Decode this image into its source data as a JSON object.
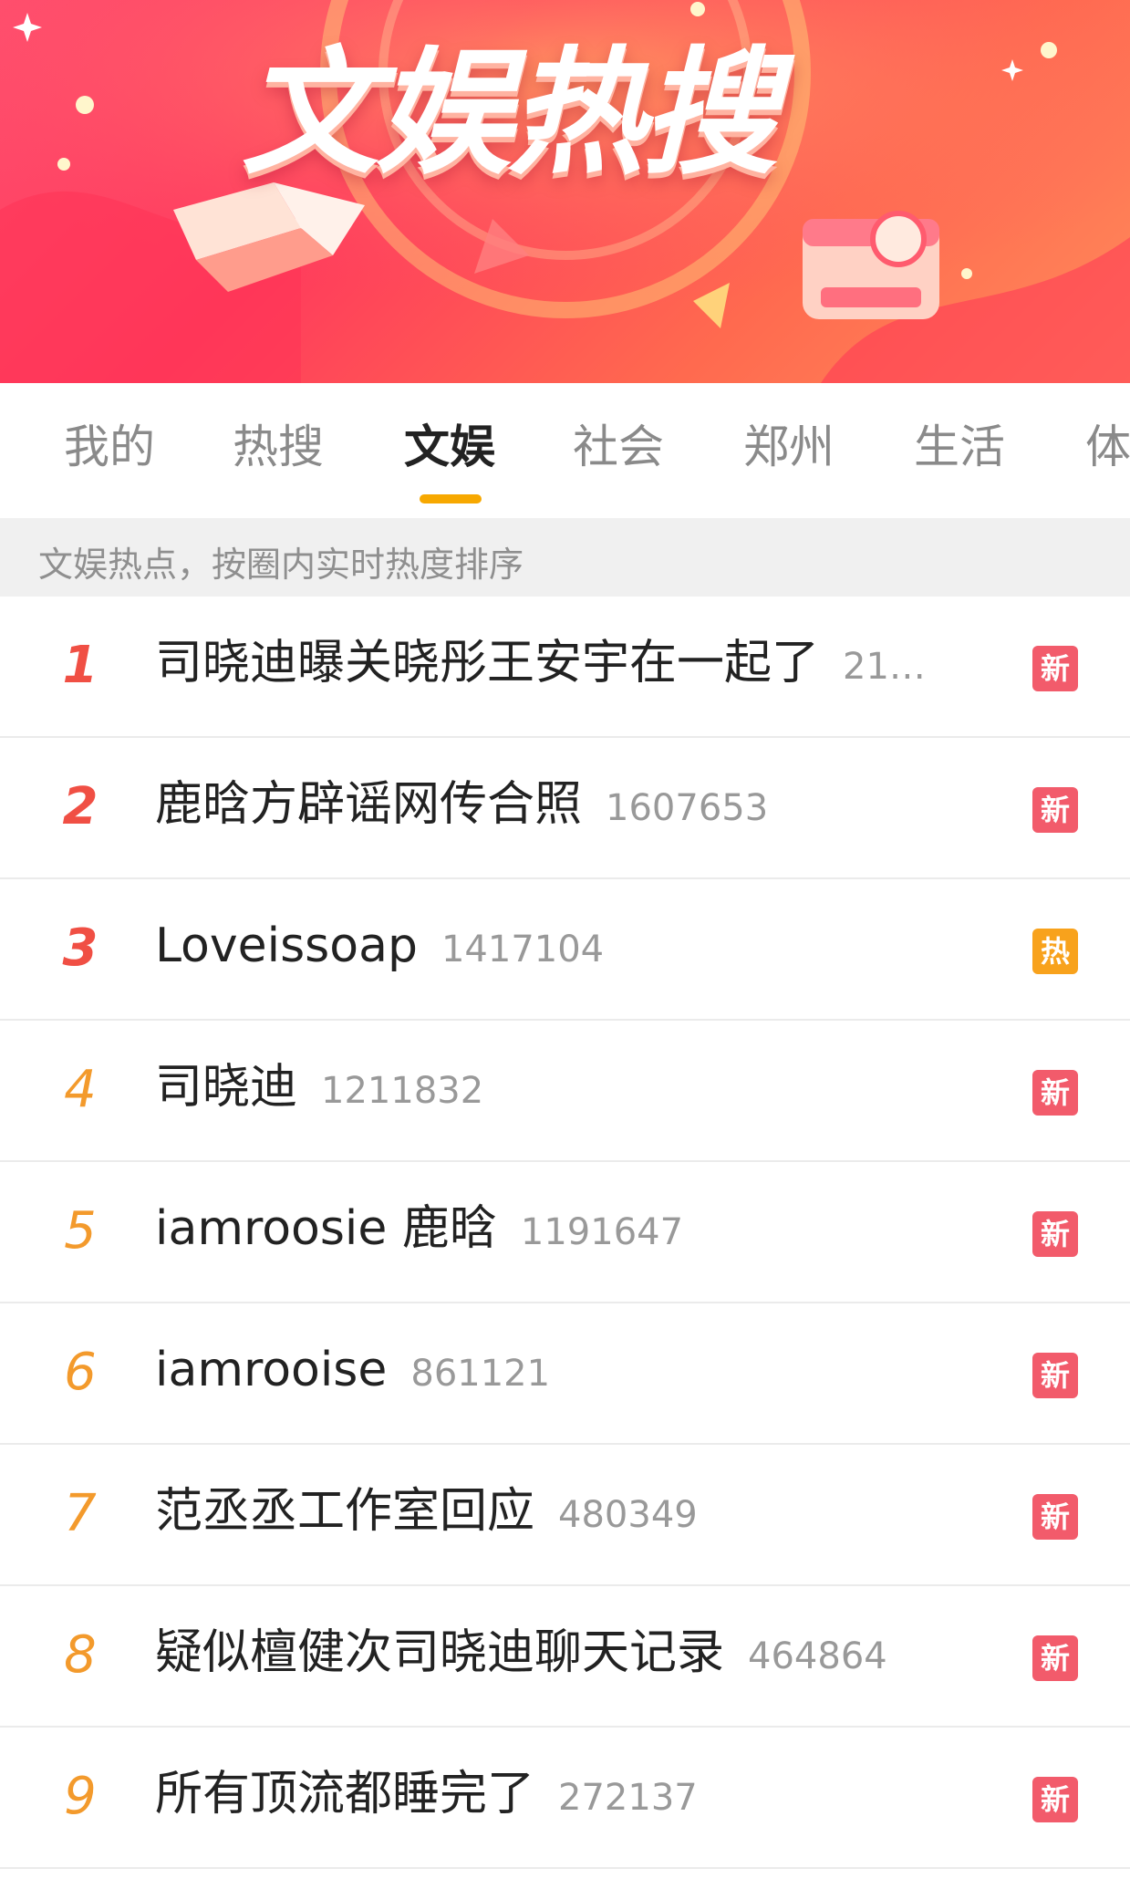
{
  "banner": {
    "title": "文娱热搜"
  },
  "tabs": [
    {
      "label": "我的",
      "active": false
    },
    {
      "label": "热搜",
      "active": false
    },
    {
      "label": "文娱",
      "active": true
    },
    {
      "label": "社会",
      "active": false
    },
    {
      "label": "郑州",
      "active": false
    },
    {
      "label": "生活",
      "active": false
    },
    {
      "label": "体",
      "active": false
    }
  ],
  "section": {
    "subtitle": "文娱热点，按圈内实时热度排序"
  },
  "colors": {
    "accent_underline": "#f7a800",
    "rank_top": "#f04f44",
    "rank_rest": "#f39a2c",
    "badge_new": "#f25b6b",
    "badge_hot": "#f8a21c"
  },
  "list": [
    {
      "rank": "1",
      "topic": "司晓迪曝关晓彤王安宇在一起了",
      "count": "21…",
      "badge": "新",
      "badge_type": "new"
    },
    {
      "rank": "2",
      "topic": "鹿晗方辟谣网传合照",
      "count": "1607653",
      "badge": "新",
      "badge_type": "new"
    },
    {
      "rank": "3",
      "topic": "Loveissoap",
      "count": "1417104",
      "badge": "热",
      "badge_type": "hot"
    },
    {
      "rank": "4",
      "topic": "司晓迪",
      "count": "1211832",
      "badge": "新",
      "badge_type": "new"
    },
    {
      "rank": "5",
      "topic": "iamroosie 鹿晗",
      "count": "1191647",
      "badge": "新",
      "badge_type": "new"
    },
    {
      "rank": "6",
      "topic": "iamrooise",
      "count": "861121",
      "badge": "新",
      "badge_type": "new"
    },
    {
      "rank": "7",
      "topic": "范丞丞工作室回应",
      "count": "480349",
      "badge": "新",
      "badge_type": "new"
    },
    {
      "rank": "8",
      "topic": "疑似檀健次司晓迪聊天记录",
      "count": "464864",
      "badge": "新",
      "badge_type": "new"
    },
    {
      "rank": "9",
      "topic": "所有顶流都睡完了",
      "count": "272137",
      "badge": "新",
      "badge_type": "new"
    }
  ]
}
